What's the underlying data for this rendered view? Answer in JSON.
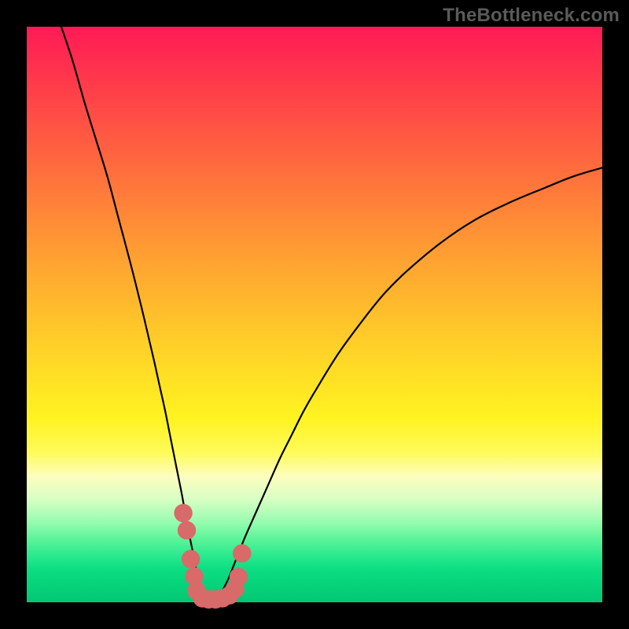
{
  "watermark": "TheBottleneck.com",
  "colors": {
    "curve": "#000000",
    "marker": "#d86a6a"
  },
  "chart_data": {
    "type": "line",
    "title": "",
    "xlabel": "",
    "ylabel": "",
    "xlim": [
      0,
      100
    ],
    "ylim": [
      0,
      100
    ],
    "grid": false,
    "note": "x and y are percentages of the plot area; (0,0) is bottom-left. Two monotone branches form a cusp near x≈32, y≈0. Right branch rises with decreasing slope toward top-right.",
    "series": [
      {
        "name": "bottleneck-curve-left",
        "x": [
          6,
          8,
          10,
          12,
          14,
          16,
          18,
          20,
          22,
          23,
          24,
          25,
          26,
          27,
          28,
          29,
          30,
          31
        ],
        "y": [
          100,
          94,
          87,
          80.5,
          74,
          66.5,
          59,
          51,
          42.5,
          38,
          33.5,
          28.5,
          23.5,
          18.5,
          13,
          8,
          3,
          0
        ]
      },
      {
        "name": "bottleneck-curve-right",
        "x": [
          33,
          34,
          35,
          36,
          37,
          38,
          40,
          42,
          44,
          46,
          48,
          50,
          54,
          58,
          62,
          66,
          72,
          78,
          84,
          90,
          95,
          100
        ],
        "y": [
          0,
          2,
          4,
          6.5,
          9,
          11.5,
          16,
          20.5,
          25,
          29,
          33,
          36.5,
          43,
          48.5,
          53.5,
          57.5,
          62.5,
          66.5,
          69.5,
          72,
          74,
          75.5
        ]
      }
    ],
    "markers": {
      "name": "highlight-dots",
      "color": "#d86a6a",
      "radius_pct": 1.6,
      "points": [
        {
          "x": 27.2,
          "y": 15.5
        },
        {
          "x": 27.8,
          "y": 12.5
        },
        {
          "x": 28.5,
          "y": 7.5
        },
        {
          "x": 29.1,
          "y": 4.5
        },
        {
          "x": 29.5,
          "y": 2.0
        },
        {
          "x": 30.5,
          "y": 0.7
        },
        {
          "x": 31.6,
          "y": 0.5
        },
        {
          "x": 32.8,
          "y": 0.5
        },
        {
          "x": 34.0,
          "y": 0.7
        },
        {
          "x": 35.2,
          "y": 1.2
        },
        {
          "x": 36.2,
          "y": 2.3
        },
        {
          "x": 36.8,
          "y": 4.4
        },
        {
          "x": 37.4,
          "y": 8.5
        }
      ]
    }
  }
}
